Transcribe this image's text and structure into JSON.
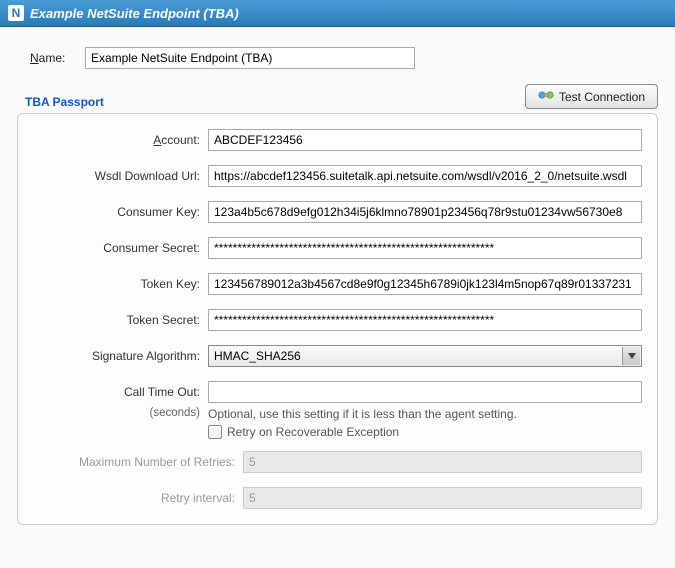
{
  "header": {
    "icon_letter": "N",
    "title": "Example NetSuite Endpoint (TBA)"
  },
  "name": {
    "label_pre": "N",
    "label_post": "ame:",
    "value": "Example NetSuite Endpoint (TBA)"
  },
  "section_title": "TBA Passport",
  "test_connection_label": "Test Connection",
  "fields": {
    "account": {
      "label_pre": "A",
      "label_post": "ccount:",
      "value": "ABCDEF123456"
    },
    "wsdl": {
      "label": "Wsdl Download Url:",
      "value": "https://abcdef123456.suitetalk.api.netsuite.com/wsdl/v2016_2_0/netsuite.wsdl"
    },
    "ckey": {
      "label": "Consumer Key:",
      "value": "123a4b5c678d9efg012h34i5j6klmno78901p23456q78r9stu01234vw56730e8"
    },
    "csecret": {
      "label": "Consumer Secret:",
      "value": "************************************************************"
    },
    "tkey": {
      "label": "Token Key:",
      "value": "123456789012a3b4567cd8e9f0g12345h6789i0jk123l4m5nop67q89r01337231"
    },
    "tsecret": {
      "label": "Token Secret:",
      "value": "************************************************************"
    },
    "sigalg": {
      "label": "Signature Algorithm:",
      "value": "HMAC_SHA256"
    },
    "timeout": {
      "label": "Call Time Out:",
      "value": ""
    },
    "timeout_unit": "(seconds)",
    "timeout_hint": "Optional, use this setting if it is less than the agent setting.",
    "retry_checkbox_label": "Retry on Recoverable Exception",
    "max_retries": {
      "label": "Maximum Number of Retries:",
      "value": "5"
    },
    "retry_interval": {
      "label": "Retry interval:",
      "value": "5"
    }
  }
}
